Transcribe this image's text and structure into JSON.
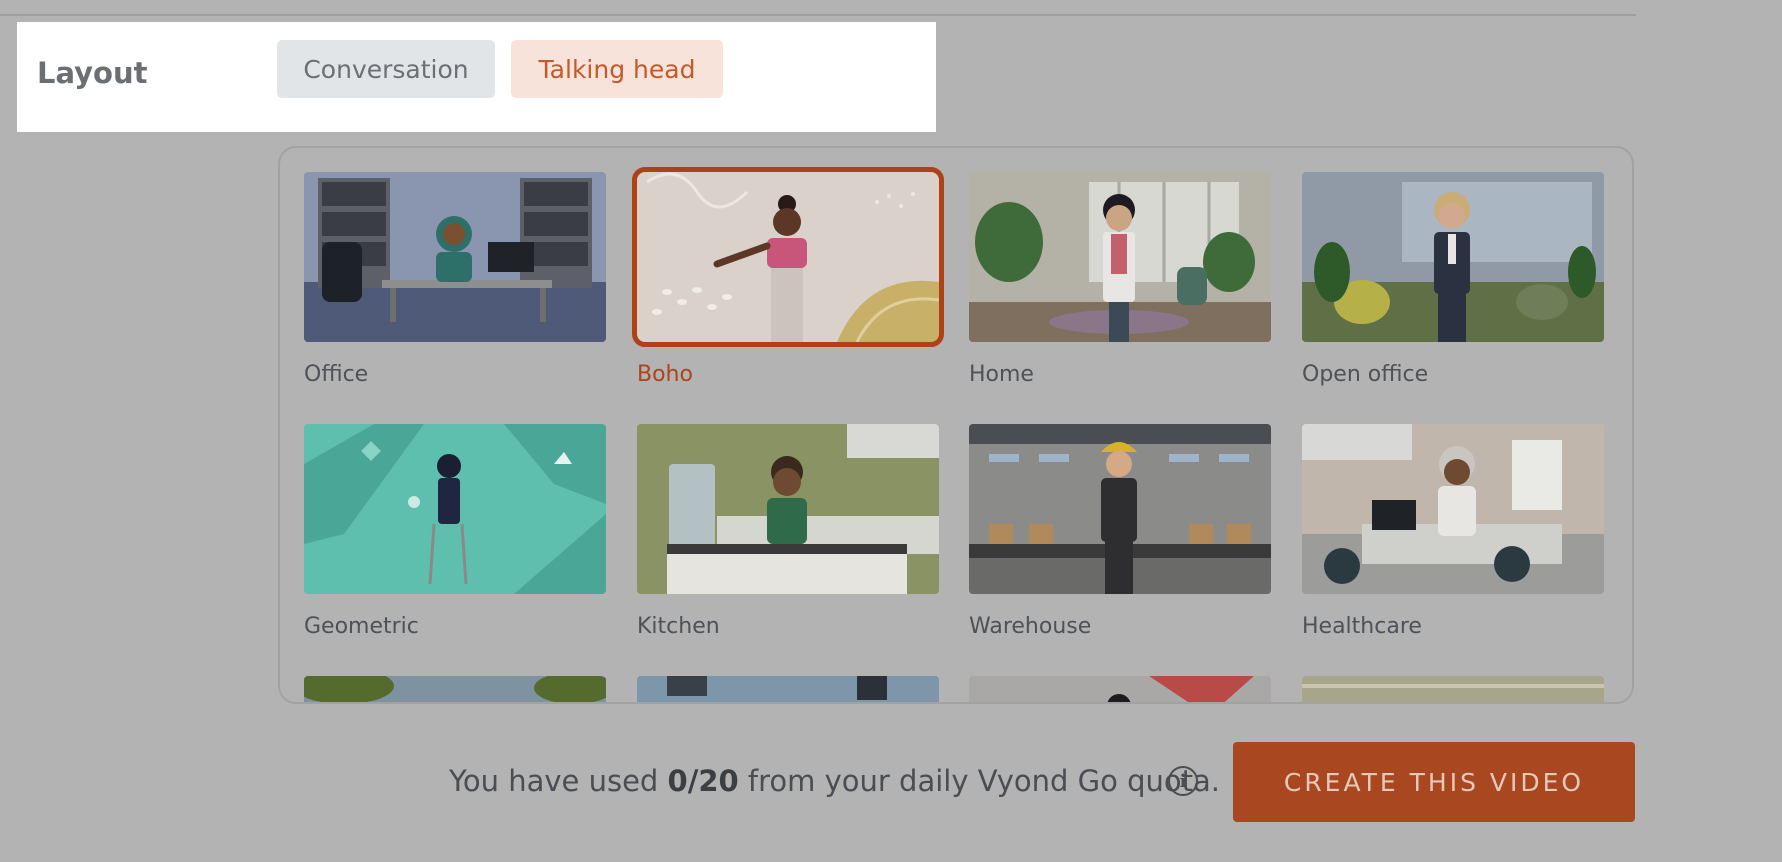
{
  "layout": {
    "label": "Layout",
    "options": [
      "Conversation",
      "Talking head"
    ],
    "selected": "Talking head"
  },
  "backgrounds": {
    "selected": "Boho",
    "items": [
      {
        "name": "Office"
      },
      {
        "name": "Boho"
      },
      {
        "name": "Home"
      },
      {
        "name": "Open office"
      },
      {
        "name": "Geometric"
      },
      {
        "name": "Kitchen"
      },
      {
        "name": "Warehouse"
      },
      {
        "name": "Healthcare"
      }
    ]
  },
  "quota": {
    "prefix": "You have used ",
    "value": "0/20",
    "suffix": " from your daily Vyond Go quota.",
    "info_icon": "info-icon"
  },
  "actions": {
    "create_label": "CREATE THIS VIDEO"
  },
  "colors": {
    "accent": "#a84720",
    "selected_border": "#ad4118"
  }
}
